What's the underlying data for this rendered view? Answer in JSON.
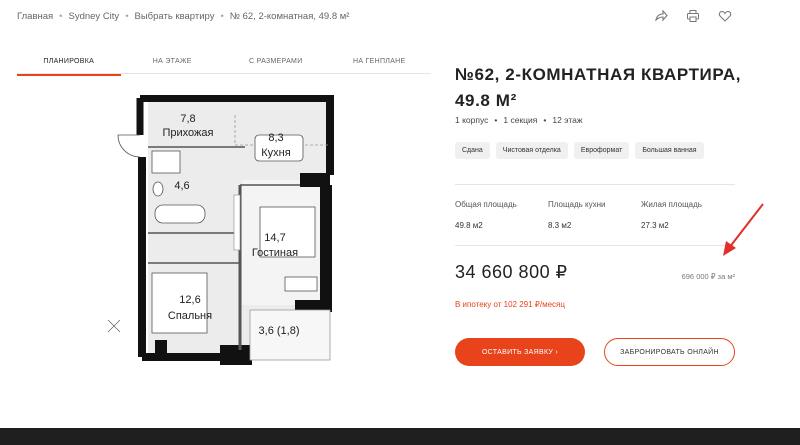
{
  "breadcrumbs": [
    "Главная",
    "Sydney City",
    "Выбрать квартиру",
    "№ 62, 2-комнатная, 49.8 м²"
  ],
  "icons": [
    "share-icon",
    "print-icon",
    "heart-icon"
  ],
  "tabs": [
    "ПЛАНИРОВКА",
    "НА ЭТАЖЕ",
    "С РАЗМЕРАМИ",
    "НА ГЕНПЛАНЕ"
  ],
  "plan": {
    "rooms": [
      {
        "area": "7,8",
        "name": "Прихожая"
      },
      {
        "area": "8,3",
        "name": "Кухня"
      },
      {
        "area": "4,6",
        "name": ""
      },
      {
        "area": "14,7",
        "name": "Гостиная"
      },
      {
        "area": "12,6",
        "name": "Спальня"
      },
      {
        "area": "3,6 (1,8)",
        "name": ""
      }
    ]
  },
  "apartment": {
    "title": "№62, 2-КОМНАТНАЯ КВАРТИРА, 49.8 М²",
    "meta": [
      "1 корпус",
      "1 секция",
      "12 этаж"
    ],
    "tags": [
      "Сдана",
      "Чистовая отделка",
      "Евроформат",
      "Большая ванная"
    ],
    "stats": [
      {
        "label": "Общая площадь",
        "value": "49.8 м2"
      },
      {
        "label": "Площадь кухни",
        "value": "8.3 м2"
      },
      {
        "label": "Жилая площадь",
        "value": "27.3 м2"
      }
    ],
    "price": "34 660 800 ₽",
    "price_per_m2": "696 000 ₽ за м²",
    "mortgage": "В ипотеку от 102 291 ₽/месяц",
    "btn_apply": "ОСТАВИТЬ ЗАЯВКУ  ›",
    "btn_reserve": "ЗАБРОНИРОВАТЬ ОНЛАЙН"
  },
  "colors": {
    "accent": "#e8431b",
    "annotation_arrow": "#e0302a"
  }
}
